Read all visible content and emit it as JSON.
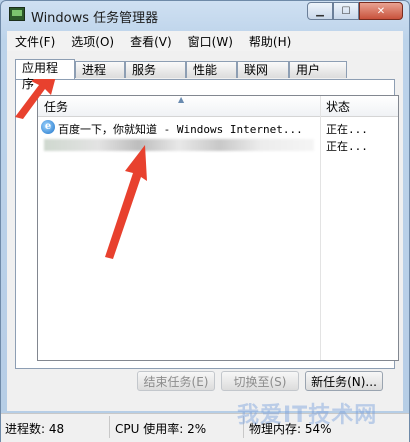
{
  "window": {
    "title": "Windows 任务管理器"
  },
  "title_buttons": {
    "minimize": "▁",
    "maximize": "☐",
    "close": "✕"
  },
  "menu": [
    "文件(F)",
    "选项(O)",
    "查看(V)",
    "窗口(W)",
    "帮助(H)"
  ],
  "tabs": [
    "应用程序",
    "进程",
    "服务",
    "性能",
    "联网",
    "用户"
  ],
  "active_tab": "应用程序",
  "table": {
    "columns": [
      "任务",
      "状态"
    ],
    "rows": [
      {
        "icon": "ie-icon",
        "name": "百度一下，你就知道 - Windows Internet...",
        "status": "正在..."
      },
      {
        "icon": "blurred",
        "name": "",
        "status": "正在..."
      }
    ]
  },
  "buttons": {
    "end_task": "结束任务(E)",
    "switch_to": "切换至(S)",
    "new_task": "新任务(N)..."
  },
  "statusbar": {
    "processes": "进程数: 48",
    "cpu": "CPU 使用率: 2%",
    "memory": "物理内存: 54%"
  },
  "watermark": "我爱IT技术网",
  "colors": {
    "annotation_arrow": "#e8412e",
    "ie_blue": "#1e73c9"
  }
}
